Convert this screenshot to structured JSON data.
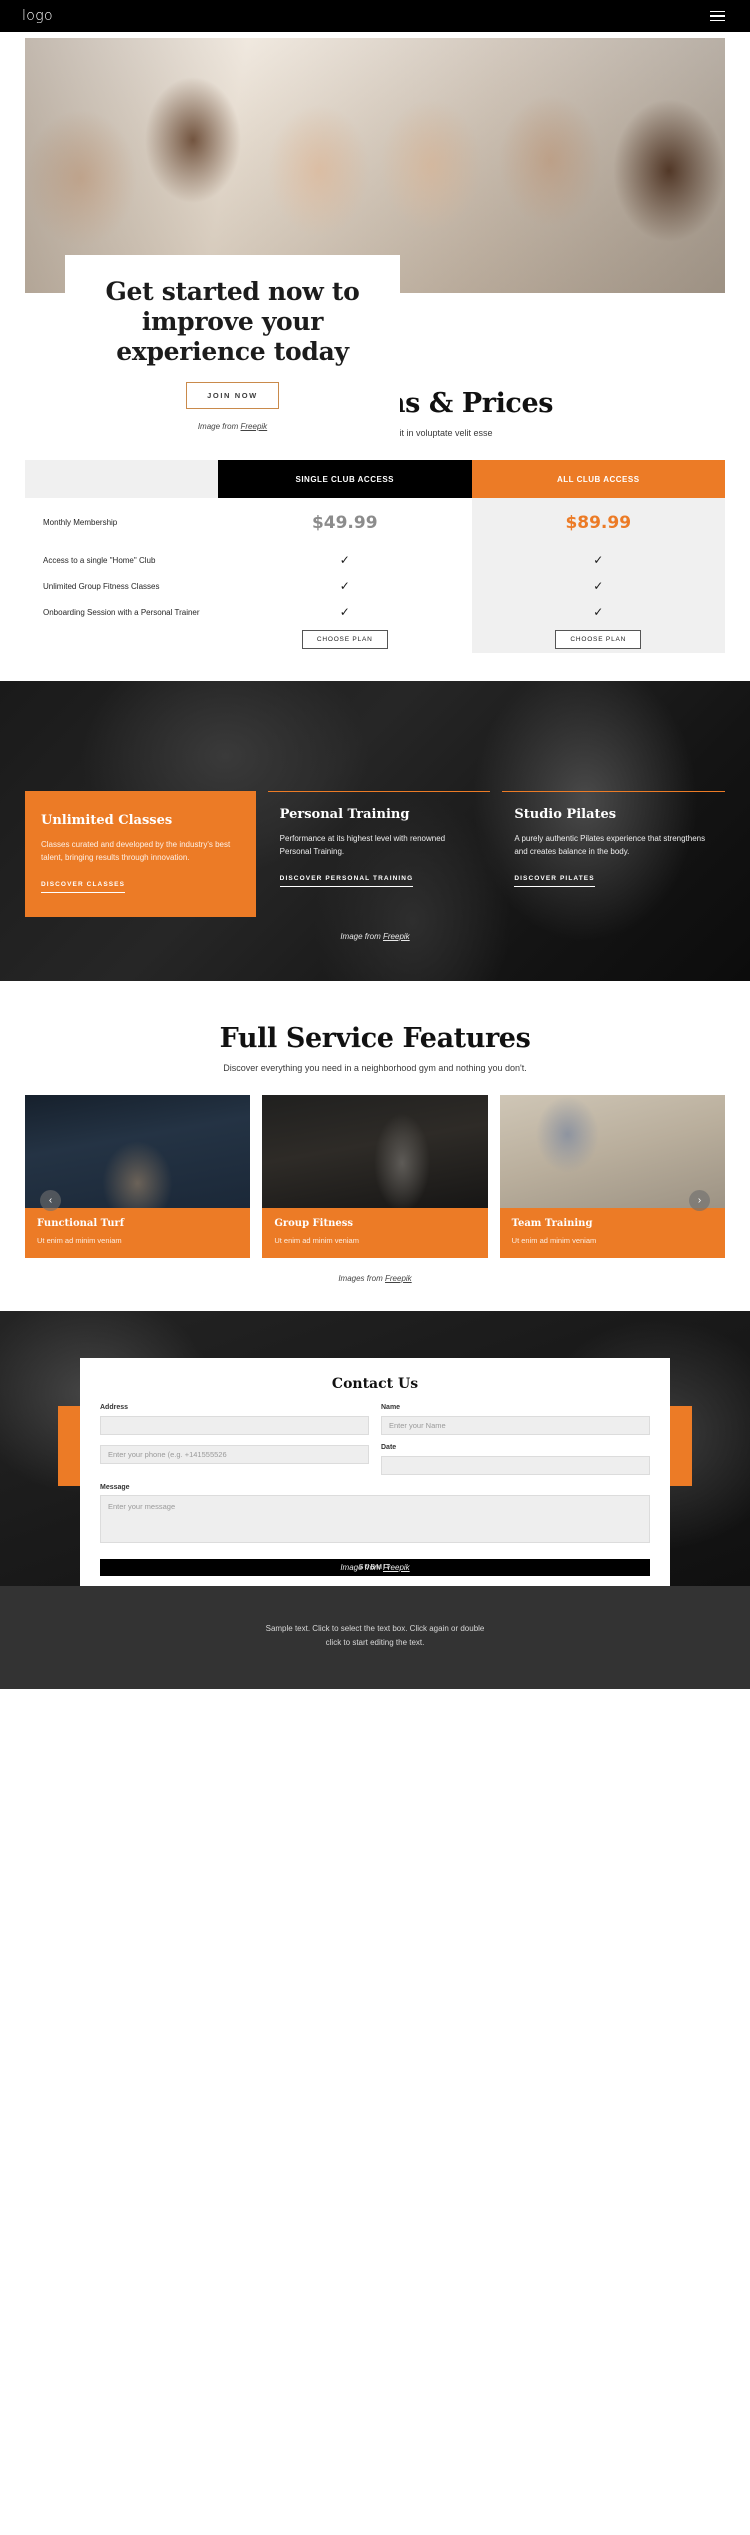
{
  "nav": {
    "logo": "logo",
    "menu_icon": "hamburger-menu-icon"
  },
  "hero": {
    "title": "Get started now to improve your experience today",
    "cta": "JOIN NOW",
    "credit_prefix": "Image from ",
    "credit_link": "Freepik"
  },
  "pricing": {
    "title": "Compare Plans & Prices",
    "subtitle": "Duis aute irure dolor in reprehenderit in voluptate velit esse",
    "columns": [
      "",
      "SINGLE CLUB ACCESS",
      "ALL CLUB ACCESS"
    ],
    "price_label": "Monthly Membership",
    "price_single": "$49.99",
    "price_all": "$89.99",
    "features": [
      "Access to a single \"Home\" Club",
      "Unlimited Group Fitness Classes",
      "Onboarding Session with a Personal Trainer"
    ],
    "check_mark": "✓",
    "choose_plan": "CHOOSE PLAN",
    "accent_black": "#000000",
    "accent_orange": "#ec7b26"
  },
  "classes": {
    "cards": [
      {
        "title": "Unlimited Classes",
        "body": "Classes curated and developed by the industry's best talent, bringing results through innovation.",
        "link": "DISCOVER CLASSES"
      },
      {
        "title": "Personal Training",
        "body": "Performance at its highest level with renowned Personal Training.",
        "link": "DISCOVER PERSONAL TRAINING"
      },
      {
        "title": "Studio Pilates",
        "body": "A purely authentic Pilates experience that strengthens and creates balance in the body.",
        "link": "DISCOVER PILATES"
      }
    ],
    "credit_prefix": "Image from ",
    "credit_link": "Freepik"
  },
  "features": {
    "title": "Full Service Features",
    "subtitle": "Discover everything you need in a neighborhood gym and nothing you don't.",
    "prev_icon": "chevron-left-icon",
    "next_icon": "chevron-right-icon",
    "cards": [
      {
        "title": "Functional Turf",
        "caption": "Ut enim ad minim veniam"
      },
      {
        "title": "Group Fitness",
        "caption": "Ut enim ad minim veniam"
      },
      {
        "title": "Team Training",
        "caption": "Ut enim ad minim veniam"
      }
    ],
    "credit_prefix": "Images from ",
    "credit_link": "Freepik"
  },
  "contact": {
    "title": "Contact Us",
    "address_label": "Address",
    "address_value": "",
    "address_placeholder": "",
    "name_label": "Name",
    "name_placeholder": "Enter your Name",
    "phone_placeholder": "Enter your phone (e.g. +141555526",
    "date_label": "Date",
    "date_placeholder": "",
    "message_label": "Message",
    "message_placeholder": "Enter your message",
    "submit": "SUBMIT",
    "credit_prefix": "Image from ",
    "credit_link": "Freepik"
  },
  "footer": {
    "line1": "Sample text. Click to select the text box. Click again or double",
    "line2": "click to start editing the text."
  }
}
